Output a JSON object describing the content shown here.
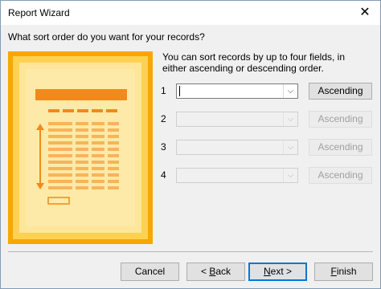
{
  "window": {
    "title": "Report Wizard",
    "close_glyph": "✕"
  },
  "question": "What sort order do you want for your records?",
  "instructions": "You can sort records by up to four fields, in either ascending or descending order.",
  "sort_rows": [
    {
      "number": "1",
      "field_value": "",
      "order": "Ascending",
      "enabled": true
    },
    {
      "number": "2",
      "field_value": "",
      "order": "Ascending",
      "enabled": false
    },
    {
      "number": "3",
      "field_value": "",
      "order": "Ascending",
      "enabled": false
    },
    {
      "number": "4",
      "field_value": "",
      "order": "Ascending",
      "enabled": false
    }
  ],
  "buttons": {
    "cancel": "Cancel",
    "back_prefix": "< ",
    "back_mnemonic": "B",
    "back_rest": "ack",
    "next_mnemonic": "N",
    "next_rest": "ext >",
    "finish_mnemonic": "F",
    "finish_rest": "inish"
  },
  "icons": {
    "dropdown": "chevron-down-icon",
    "close": "close-icon",
    "illustration": "report-sort-illustration"
  },
  "colors": {
    "illustration_bg": "#f6a800",
    "illustration_panel": "#fde699",
    "accent": "#f08a1c",
    "default_button_border": "#0078d7"
  }
}
